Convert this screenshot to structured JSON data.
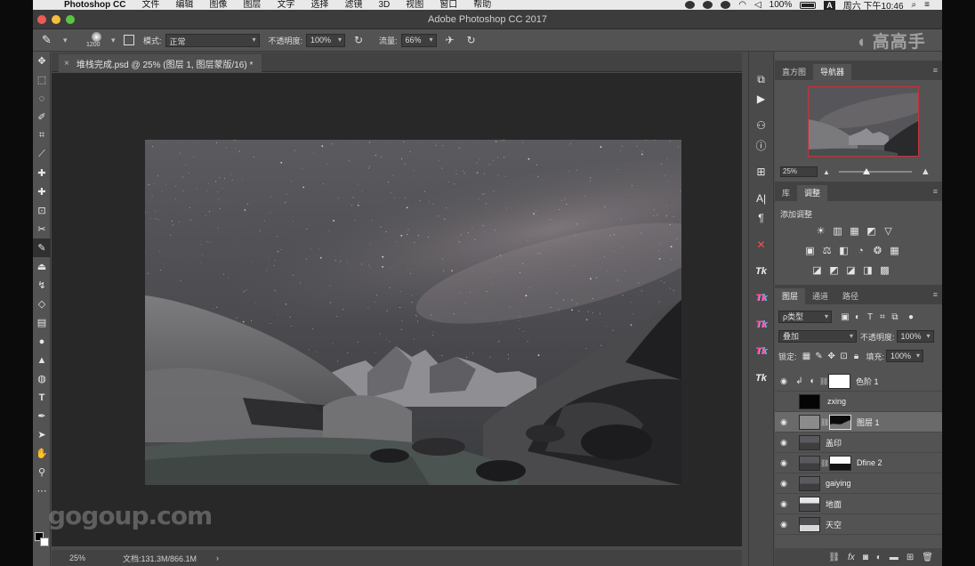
{
  "menubar": {
    "app": "Photoshop CC",
    "items": [
      "文件",
      "编辑",
      "图像",
      "图层",
      "文字",
      "选择",
      "滤镜",
      "3D",
      "视图",
      "窗口",
      "帮助"
    ],
    "battery": "100%",
    "clock": "周六 下午10:46",
    "input_badge": "A"
  },
  "window": {
    "title": "Adobe Photoshop CC 2017"
  },
  "options": {
    "brush_size": "1200",
    "mode_label": "模式:",
    "mode_value": "正常",
    "opacity_label": "不透明度:",
    "opacity_value": "100%",
    "flow_label": "流量:",
    "flow_value": "66%"
  },
  "document": {
    "tab_title": "堆栈完成.psd @ 25% (图层 1, 图层蒙版/16) *",
    "zoom": "25%",
    "doc_size": "文档:131.3M/866.1M",
    "status_arrow": "›",
    "watermark": "gogoup.com"
  },
  "brand": "高高手",
  "navigator": {
    "tabs": [
      "直方图",
      "导航器"
    ],
    "active_tab": 1,
    "zoom": "25%"
  },
  "adjustments": {
    "tabs": [
      "库",
      "调整"
    ],
    "active_tab": 1,
    "title": "添加调整",
    "rows": [
      [
        "☀",
        "▥",
        "▦",
        "◩",
        "▽"
      ],
      [
        "▣",
        "⚖",
        "◧",
        "◔",
        "❂",
        "▦"
      ],
      [
        "◪",
        "◩",
        "◪",
        "◨",
        "▩"
      ]
    ]
  },
  "layers_panel": {
    "tabs": [
      "图层",
      "通道",
      "路径"
    ],
    "active_tab": 0,
    "filter_kind": "ρ类型",
    "blend_mode": "叠加",
    "opacity_label": "不透明度:",
    "opacity_value": "100%",
    "lock_label": "锁定:",
    "fill_label": "填充:",
    "fill_value": "100%",
    "layers": [
      {
        "name": "色阶 1",
        "visible": true,
        "type": "adjustment",
        "selected": false
      },
      {
        "name": "zxing",
        "visible": false,
        "type": "pixel",
        "selected": false
      },
      {
        "name": "图层 1",
        "visible": true,
        "type": "masked",
        "selected": true
      },
      {
        "name": "盖印",
        "visible": true,
        "type": "pixel",
        "selected": false
      },
      {
        "name": "Dfine 2",
        "visible": true,
        "type": "masked",
        "selected": false
      },
      {
        "name": "gaiying",
        "visible": true,
        "type": "pixel",
        "selected": false
      },
      {
        "name": "地面",
        "visible": true,
        "type": "pixel",
        "selected": false
      },
      {
        "name": "天空",
        "visible": true,
        "type": "pixel",
        "selected": false
      }
    ]
  },
  "dock": {
    "items": [
      "history-icon",
      "play-icon",
      "learn-icon",
      "info-icon",
      "properties-icon",
      "character-icon",
      "paragraph-icon",
      "close-panel-icon",
      "tk-icon-1",
      "tk-icon-2",
      "tk-icon-3",
      "tk-icon-4",
      "tk-icon-5"
    ]
  },
  "colors": {
    "accent_red": "#c8323a",
    "panel": "#535353",
    "canvas_bg": "#282828"
  }
}
